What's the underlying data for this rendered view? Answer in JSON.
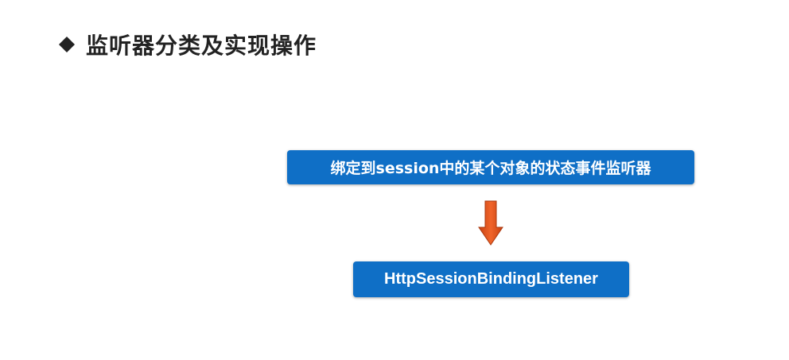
{
  "title": {
    "bullet_icon": "diamond-bullet-icon",
    "text": "监听器分类及实现操作"
  },
  "diagram": {
    "top_box": "绑定到session中的某个对象的状态事件监听器",
    "arrow_icon": "down-arrow-icon",
    "bottom_box": "HttpSessionBindingListener",
    "colors": {
      "box_fill": "#0f6fc6",
      "box_text": "#ffffff",
      "arrow_fill": "#e0521c"
    }
  }
}
